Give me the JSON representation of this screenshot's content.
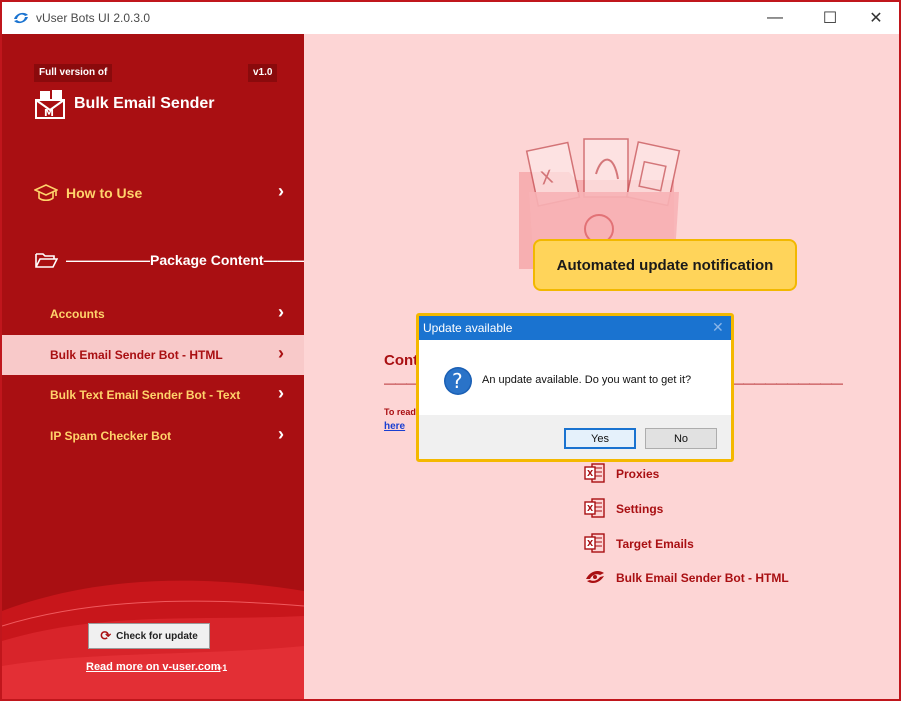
{
  "window": {
    "title": "vUser Bots UI 2.0.3.0",
    "minimize": "—",
    "maximize": "☐",
    "close": "✕"
  },
  "sidebar": {
    "badge_full": "Full version of",
    "badge_version": "v1.0",
    "brand_title": "Bulk Email Sender",
    "how_to_use": "How to Use",
    "package_content": "——————Package Content————————",
    "items": [
      {
        "label": "Accounts",
        "active": false
      },
      {
        "label": "Bulk Email Sender Bot - HTML",
        "active": true
      },
      {
        "label": "Bulk Text Email Sender Bot - Text",
        "active": false
      },
      {
        "label": "IP Spam Checker Bot",
        "active": false
      }
    ],
    "check_update": "Check for update",
    "read_more": "Read more on v-user.com",
    "read_more_badge": "+1"
  },
  "main": {
    "callout": "Automated update notification",
    "content_title": "Cont",
    "dashes_left": "————",
    "dashes_right": "——————————",
    "to_read": "To read",
    "here": "here",
    "files": [
      {
        "label": "Proxies",
        "icon": "excel-file-icon"
      },
      {
        "label": "Settings",
        "icon": "excel-file-icon"
      },
      {
        "label": "Target Emails",
        "icon": "excel-file-icon"
      },
      {
        "label": "Bulk Email Sender Bot -  HTML",
        "icon": "bot-icon"
      }
    ]
  },
  "dialog": {
    "title": "Update available",
    "close": "✕",
    "message": "An update available. Do you want to get it?",
    "yes": "Yes",
    "no": "No"
  },
  "colors": {
    "primary_red": "#a90f12",
    "main_bg": "#fdd5d5",
    "accent_yellow": "#ffd36b",
    "callout_yellow": "#ffd45a",
    "dialog_blue": "#1a73d0"
  }
}
